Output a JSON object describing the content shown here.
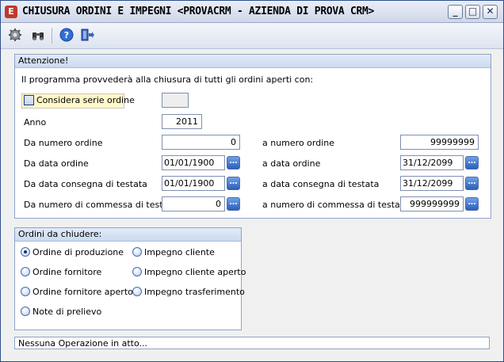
{
  "window": {
    "title": "CHIUSURA ORDINI E IMPEGNI <PROVACRM - AZIENDA DI PROVA CRM>",
    "icon_letter": "E",
    "minimize_glyph": "_",
    "maximize_glyph": "□",
    "close_glyph": "✕"
  },
  "toolbar": {
    "icons": [
      "gear-icon",
      "binoculars-icon",
      "help-icon",
      "exit-icon"
    ]
  },
  "attention": {
    "title": "Attenzione!",
    "message": "Il programma provvederà alla chiusura di tutti gli ordini aperti con:",
    "considera_serie_label": "Considera serie ordine",
    "serie_value": "",
    "anno_label": "Anno",
    "anno_value": "2011",
    "da_numero_ordine_label": "Da numero ordine",
    "da_numero_ordine_value": "0",
    "a_numero_ordine_label": "a numero ordine",
    "a_numero_ordine_value": "99999999",
    "da_data_ordine_label": "Da data ordine",
    "da_data_ordine_value": "01/01/1900",
    "a_data_ordine_label": "a data ordine",
    "a_data_ordine_value": "31/12/2099",
    "da_data_consegna_label": "Da data consegna di testata",
    "da_data_consegna_value": "01/01/1900",
    "a_data_consegna_label": "a data consegna di testata",
    "a_data_consegna_value": "31/12/2099",
    "da_commessa_label": "Da numero di commessa di testata",
    "da_commessa_value": "0",
    "a_commessa_label": "a numero di commessa di testata",
    "a_commessa_value": "999999999",
    "dots_glyph": "…"
  },
  "orders": {
    "title": "Ordini da chiudere:",
    "options": [
      {
        "label": "Ordine di produzione",
        "selected": true
      },
      {
        "label": "Ordine fornitore",
        "selected": false
      },
      {
        "label": "Ordine fornitore aperto",
        "selected": false
      },
      {
        "label": "Note di prelievo",
        "selected": false
      },
      {
        "label": "Impegno cliente",
        "selected": false
      },
      {
        "label": "Impegno cliente aperto",
        "selected": false
      },
      {
        "label": "Impegno trasferimento",
        "selected": false
      }
    ]
  },
  "status": {
    "text": "Nessuna Operazione in atto..."
  }
}
